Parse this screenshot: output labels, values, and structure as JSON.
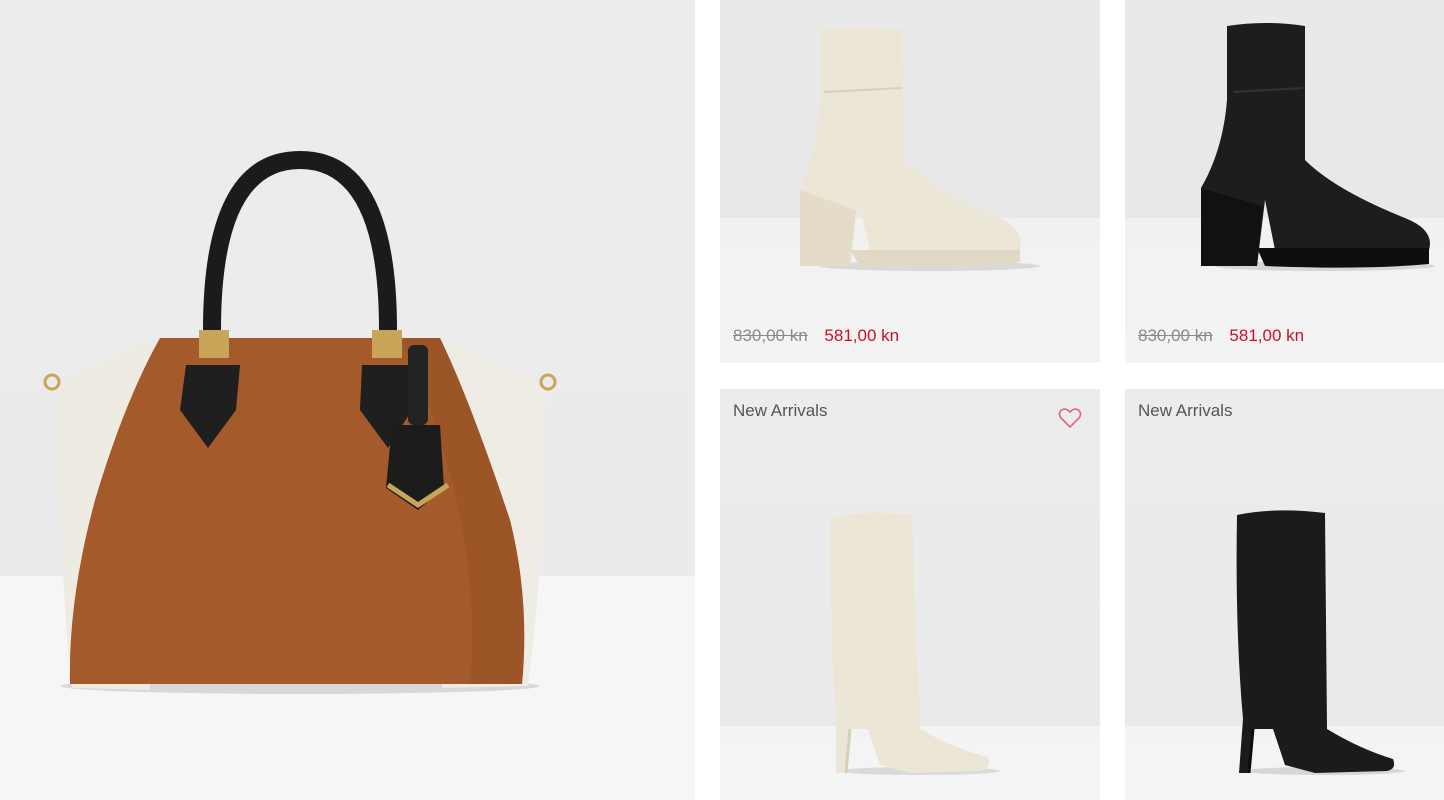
{
  "hero": {
    "product": "handbag-image"
  },
  "products": [
    {
      "image": "white-heeled-ankle-boot-image",
      "old_price": "830,00 kn",
      "new_price": "581,00 kn"
    },
    {
      "image": "black-heeled-ankle-boot-image",
      "old_price": "830,00 kn",
      "new_price": "581,00 kn"
    },
    {
      "image": "white-knee-high-boot-image",
      "badge": "New Arrivals",
      "wishlist_icon": "heart-icon"
    },
    {
      "image": "black-knee-high-boot-image",
      "badge": "New Arrivals"
    }
  ],
  "colors": {
    "sale": "#c8102e",
    "old_price": "#8a8a8a",
    "badge_text": "#555555",
    "heart": "#e8607a"
  }
}
